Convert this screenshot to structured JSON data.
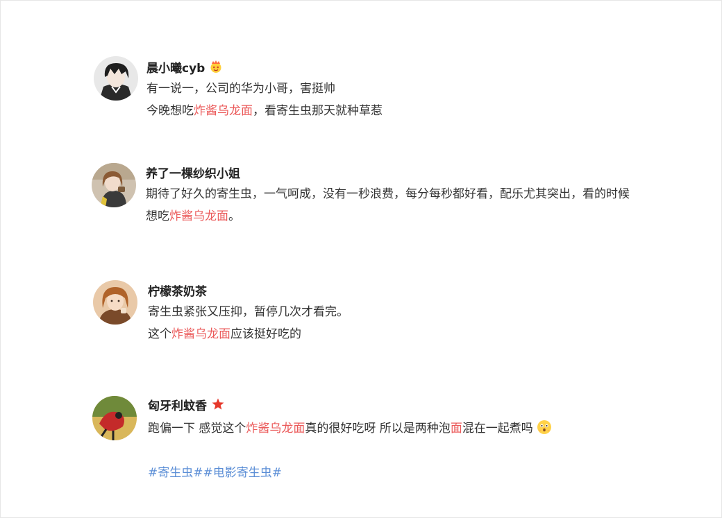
{
  "colors": {
    "highlight": "#eb5a5a",
    "topic": "#5b8ed6",
    "text": "#333333",
    "name": "#222222"
  },
  "comments": [
    {
      "name": "晨小曦cyb",
      "badge_icon": "crown-face-icon",
      "lines": [
        {
          "a": "有一说一，公司的华为小哥，害挺帅"
        },
        {
          "a": "今晚想吃",
          "hl": "炸酱乌龙面",
          "b": "，看寄生虫那天就种草惹"
        }
      ]
    },
    {
      "name": "养了一棵纱织小姐",
      "lines": [
        {
          "a": "期待了好久的寄生虫，一气呵成，没有一秒浪费，每分每秒都好看，配乐尤其突出，看的时候"
        },
        {
          "a": "想吃",
          "hl": "炸酱乌龙面",
          "b": "。"
        }
      ]
    },
    {
      "name": "柠檬茶奶茶",
      "lines": [
        {
          "a": "寄生虫紧张又压抑，暂停几次才看完。"
        },
        {
          "a": "这个",
          "hl": "炸酱乌龙面",
          "b": "应该挺好吃的"
        }
      ]
    },
    {
      "name": "匈牙利蚊香",
      "badge_icon": "red-star-icon",
      "lines": [
        {
          "a": "跑偏一下 感觉这个",
          "hl": "炸酱乌龙面",
          "b": "真的很好吃呀 所以是两种泡",
          "hl2": "面",
          "c": "混在一起煮吗"
        }
      ],
      "emoji_icon": "surprised-face-emoji-icon"
    }
  ],
  "tags": [
    "#寄生虫#",
    "#电影寄生虫#"
  ]
}
